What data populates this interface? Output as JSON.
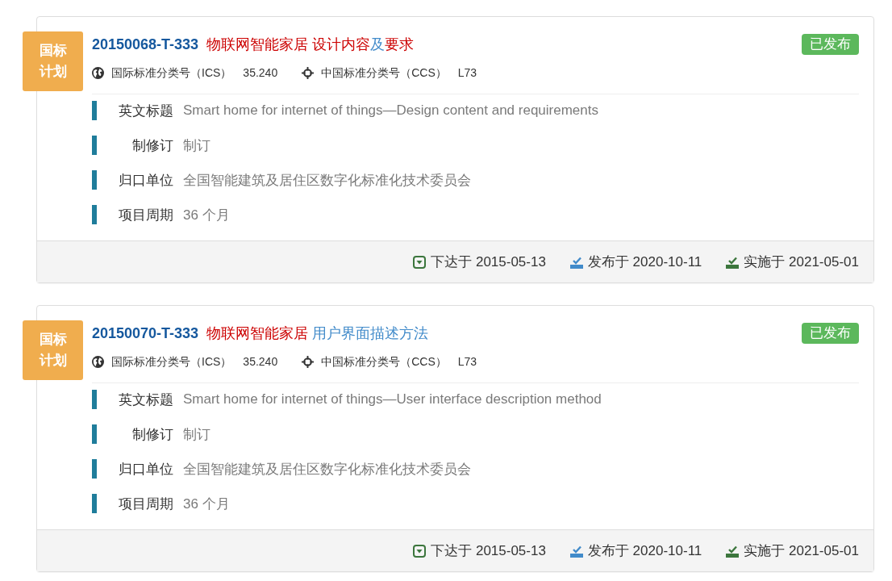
{
  "standards": [
    {
      "category": "国标计划",
      "code": "20150068-T-333",
      "title": [
        {
          "text": "物联网智能家居 设计内容",
          "highlighted": true
        },
        {
          "text": "及",
          "highlighted": false
        },
        {
          "text": "要求",
          "highlighted": true
        }
      ],
      "status": "已发布",
      "classifications": [
        {
          "kind": "ics",
          "label": "国际标准分类号（ICS）",
          "value": "35.240"
        },
        {
          "kind": "ccs",
          "label": "中国标准分类号（CCS）",
          "value": "L73"
        }
      ],
      "fields": [
        {
          "label": "英文标题",
          "value": "Smart home for internet of things—Design content and requirements"
        },
        {
          "label": "制修订",
          "value": "制订"
        },
        {
          "label": "归口单位",
          "value": "全国智能建筑及居住区数字化标准化技术委员会"
        },
        {
          "label": "项目周期",
          "value": "36 个月"
        }
      ],
      "dates": [
        {
          "kind": "issued",
          "text": "下达于 2015-05-13"
        },
        {
          "kind": "published",
          "text": "发布于 2020-10-11"
        },
        {
          "kind": "implemented",
          "text": "实施于 2021-05-01"
        }
      ]
    },
    {
      "category": "国标计划",
      "code": "20150070-T-333",
      "title": [
        {
          "text": "物联网智能家居",
          "highlighted": true
        },
        {
          "text": " 用户界面描述方法",
          "highlighted": false
        }
      ],
      "status": "已发布",
      "classifications": [
        {
          "kind": "ics",
          "label": "国际标准分类号（ICS）",
          "value": "35.240"
        },
        {
          "kind": "ccs",
          "label": "中国标准分类号（CCS）",
          "value": "L73"
        }
      ],
      "fields": [
        {
          "label": "英文标题",
          "value": "Smart home for internet of things—User interface description method"
        },
        {
          "label": "制修订",
          "value": "制订"
        },
        {
          "label": "归口单位",
          "value": "全国智能建筑及居住区数字化标准化技术委员会"
        },
        {
          "label": "项目周期",
          "value": "36 个月"
        }
      ],
      "dates": [
        {
          "kind": "issued",
          "text": "下达于 2015-05-13"
        },
        {
          "kind": "published",
          "text": "发布于 2020-10-11"
        },
        {
          "kind": "implemented",
          "text": "实施于 2021-05-01"
        }
      ]
    }
  ]
}
